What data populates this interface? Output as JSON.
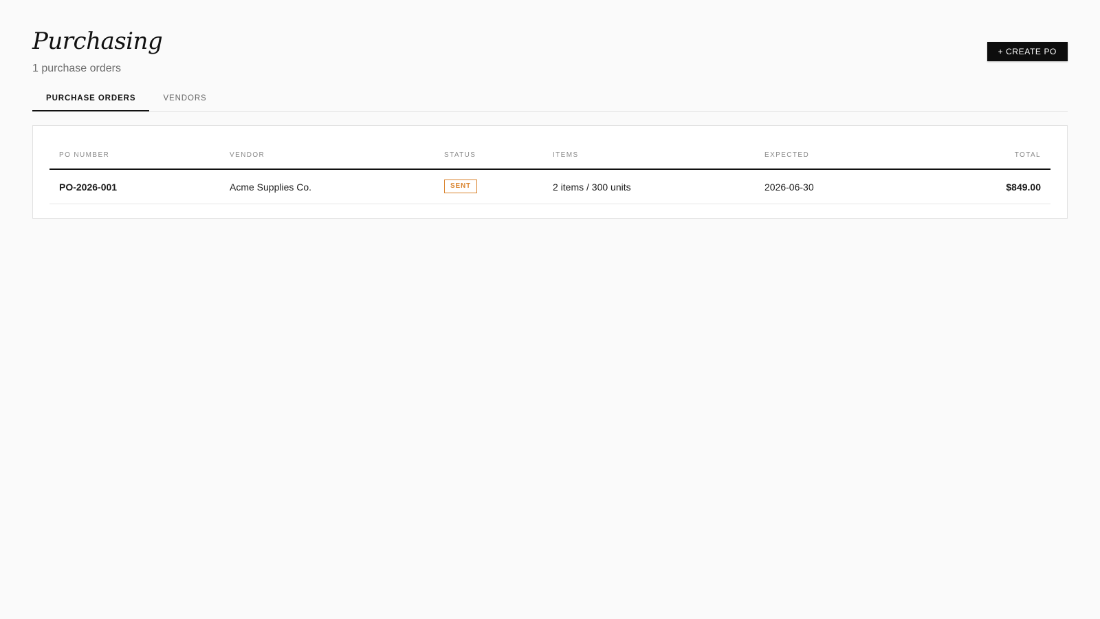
{
  "header": {
    "title": "Purchasing",
    "subtitle": "1 purchase orders",
    "create_button_label": "+ CREATE PO"
  },
  "tabs": [
    {
      "label": "PURCHASE ORDERS",
      "active": true
    },
    {
      "label": "VENDORS",
      "active": false
    }
  ],
  "table": {
    "columns": {
      "po_number": "PO NUMBER",
      "vendor": "VENDOR",
      "status": "STATUS",
      "items": "ITEMS",
      "expected": "EXPECTED",
      "total": "TOTAL"
    },
    "rows": [
      {
        "po_number": "PO-2026-001",
        "vendor": "Acme Supplies Co.",
        "status": "SENT",
        "items": "2 items / 300 units",
        "expected": "2026-06-30",
        "total": "$849.00"
      }
    ]
  },
  "colors": {
    "background": "#fafafa",
    "primary_button": "#0d0d0d",
    "status_sent": "#d9822b",
    "muted_text": "#8a8a8a"
  }
}
